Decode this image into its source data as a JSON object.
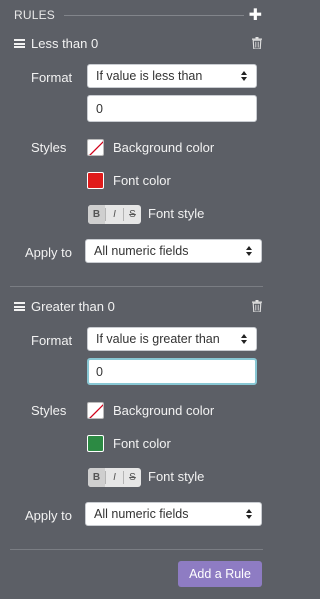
{
  "header": {
    "title": "RULES",
    "add_icon": "plus-icon"
  },
  "rules": [
    {
      "title": "Less than 0",
      "format_label": "Format",
      "condition": "If value is less than",
      "value": "0",
      "styles_label": "Styles",
      "background_label": "Background color",
      "background_color": "none",
      "font_color_label": "Font color",
      "font_color": "#e01b1b",
      "font_style_label": "Font style",
      "font_style_buttons": [
        "B",
        "I",
        "S"
      ],
      "apply_label": "Apply to",
      "apply_to": "All numeric fields"
    },
    {
      "title": "Greater than 0",
      "format_label": "Format",
      "condition": "If value is greater than",
      "value": "0",
      "styles_label": "Styles",
      "background_label": "Background color",
      "background_color": "none",
      "font_color_label": "Font color",
      "font_color": "#2c8a43",
      "font_style_label": "Font style",
      "font_style_buttons": [
        "B",
        "I",
        "S"
      ],
      "apply_label": "Apply to",
      "apply_to": "All numeric fields"
    }
  ],
  "footer": {
    "add_rule_label": "Add a Rule",
    "accent_color": "#8e7cc3"
  }
}
